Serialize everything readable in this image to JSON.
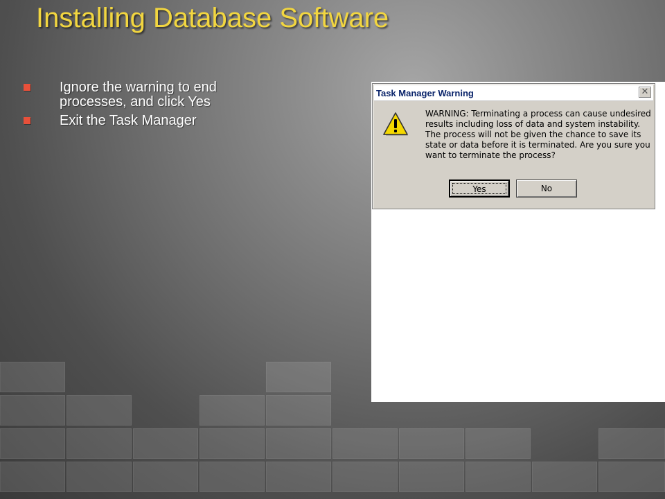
{
  "slide": {
    "title": "Installing Database Software",
    "bullets": [
      {
        "text": "Ignore the warning to end processes, and click Yes"
      },
      {
        "text": "Exit the Task Manager"
      }
    ]
  },
  "dialog": {
    "title": "Task Manager Warning",
    "close_glyph": "✕",
    "icon": "warning-icon",
    "message": "WARNING: Terminating a process can cause undesired results including loss of data and system instability. The process will not be given the chance to save its state or data before it is terminated.  Are you sure you want to terminate the process?",
    "yes_label": "Yes",
    "no_label": "No"
  },
  "colors": {
    "title": "#f2d640",
    "bullet_marker": "#e8503a",
    "dialog_face": "#d4d0c8",
    "dialog_title": "#0a246a"
  }
}
